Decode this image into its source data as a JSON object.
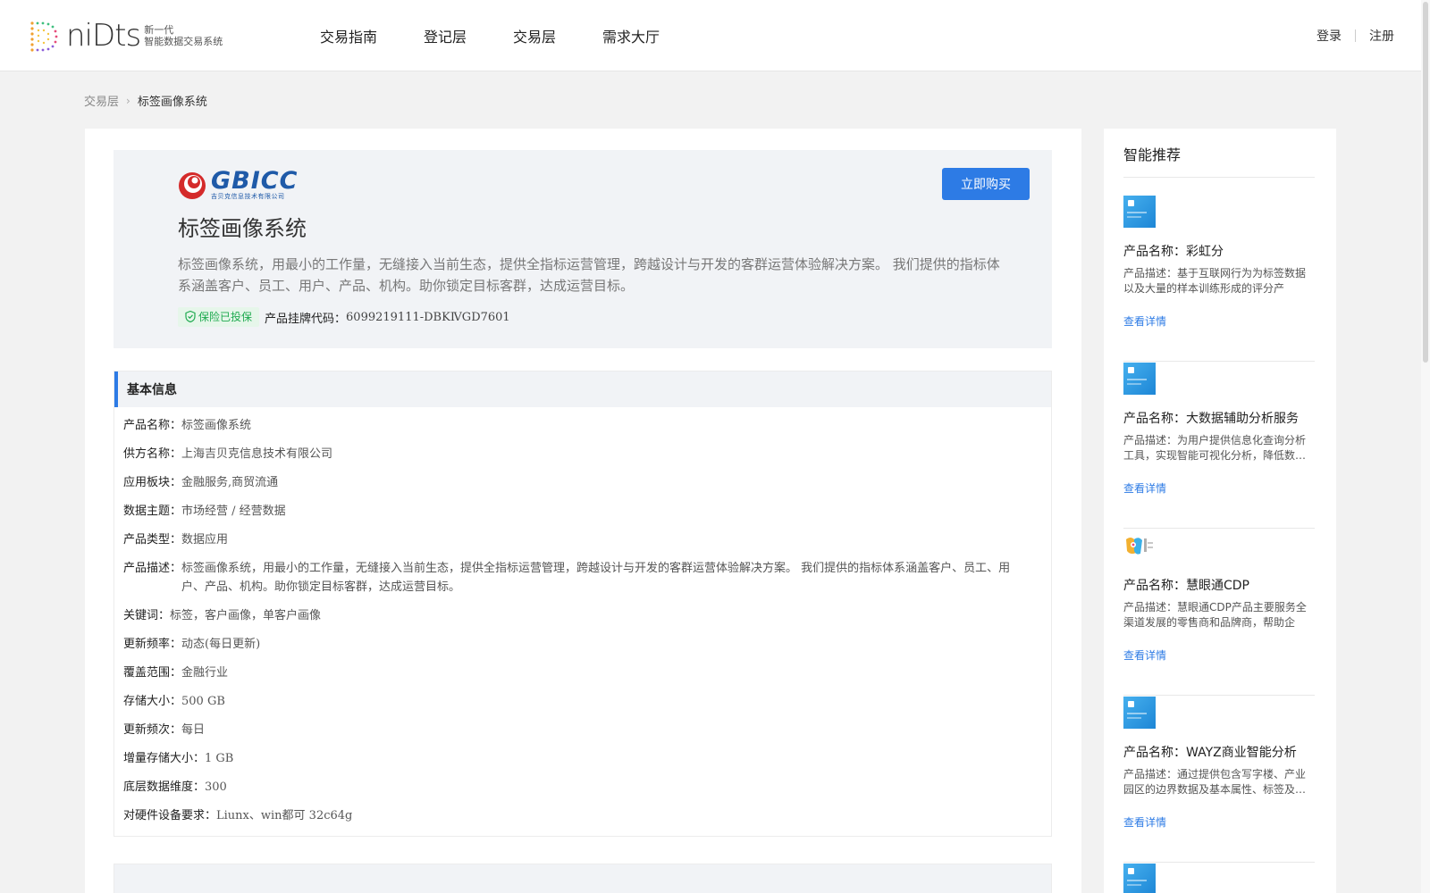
{
  "header": {
    "logo_wordmark": "niDts",
    "logo_sub_line1": "新一代",
    "logo_sub_line2": "智能数据交易系统",
    "nav": [
      "交易指南",
      "登记层",
      "交易层",
      "需求大厅"
    ],
    "login": "登录",
    "register": "注册"
  },
  "breadcrumb": {
    "parent": "交易层",
    "current": "标签画像系统"
  },
  "product": {
    "brand_name": "GBICC",
    "brand_cn": "吉贝克信息技术有限公司",
    "title": "标签画像系统",
    "description": "标签画像系统，用最小的工作量，无缝接入当前生态，提供全指标运营管理，跨越设计与开发的客群运营体验解决方案。 我们提供的指标体系涵盖客户、员工、用户、产品、机构。助你锁定目标客群，达成运营目标。",
    "insurance_badge": "保险已投保",
    "code_label": "产品挂牌代码：",
    "code_value": "6099219111-DBKⅣGD7601",
    "buy_button": "立即购买"
  },
  "basic_info": {
    "title": "基本信息",
    "rows": [
      {
        "label": "产品名称：",
        "value": "标签画像系统"
      },
      {
        "label": "供方名称：",
        "value": "上海吉贝克信息技术有限公司"
      },
      {
        "label": "应用板块：",
        "value": "金融服务,商贸流通"
      },
      {
        "label": "数据主题：",
        "value": "市场经营 / 经营数据"
      },
      {
        "label": "产品类型：",
        "value": "数据应用"
      },
      {
        "label": "产品描述：",
        "value": "标签画像系统，用最小的工作量，无缝接入当前生态，提供全指标运营管理，跨越设计与开发的客群运营体验解决方案。 我们提供的指标体系涵盖客户、员工、用户、产品、机构。助你锁定目标客群，达成运营目标。"
      },
      {
        "label": "关键词：",
        "value": "标签，客户画像，单客户画像"
      },
      {
        "label": "更新频率：",
        "value": "动态(每日更新)"
      },
      {
        "label": "覆盖范围：",
        "value": "金融行业"
      },
      {
        "label": "存储大小：",
        "value": "500 GB"
      },
      {
        "label": "更新频次：",
        "value": "每日"
      },
      {
        "label": "增量存储大小：",
        "value": "1 GB"
      },
      {
        "label": "底层数据维度：",
        "value": "300"
      },
      {
        "label": "对硬件设备要求：",
        "value": "Liunx、win都可 32c64g"
      }
    ]
  },
  "sidebar": {
    "title": "智能推荐",
    "link_label": "查看详情",
    "items": [
      {
        "name": "产品名称：彩虹分",
        "desc": "产品描述：基于互联网行为为标签数据以及大量的样本训练形成的评分产品，…",
        "thumb": "blue"
      },
      {
        "name": "产品名称：大数据辅助分析服务",
        "desc": "产品描述：为用户提供信息化查询分析工具，实现智能可视化分析，降低数…",
        "thumb": "blue"
      },
      {
        "name": "产品名称：慧眼通CDP",
        "desc": "产品描述：慧眼通CDP产品主要服务全渠道发展的零售商和品牌商，帮助企业…",
        "thumb": "logo"
      },
      {
        "name": "产品名称：WAYZ商业智能分析",
        "desc": "产品描述：通过提供包含写字楼、产业园区的边界数据及基本属性、标签及…",
        "thumb": "blue"
      }
    ]
  },
  "colors": {
    "accent": "#2d7be5",
    "success": "#1eaa4f",
    "brand": "#1f5aa8"
  }
}
